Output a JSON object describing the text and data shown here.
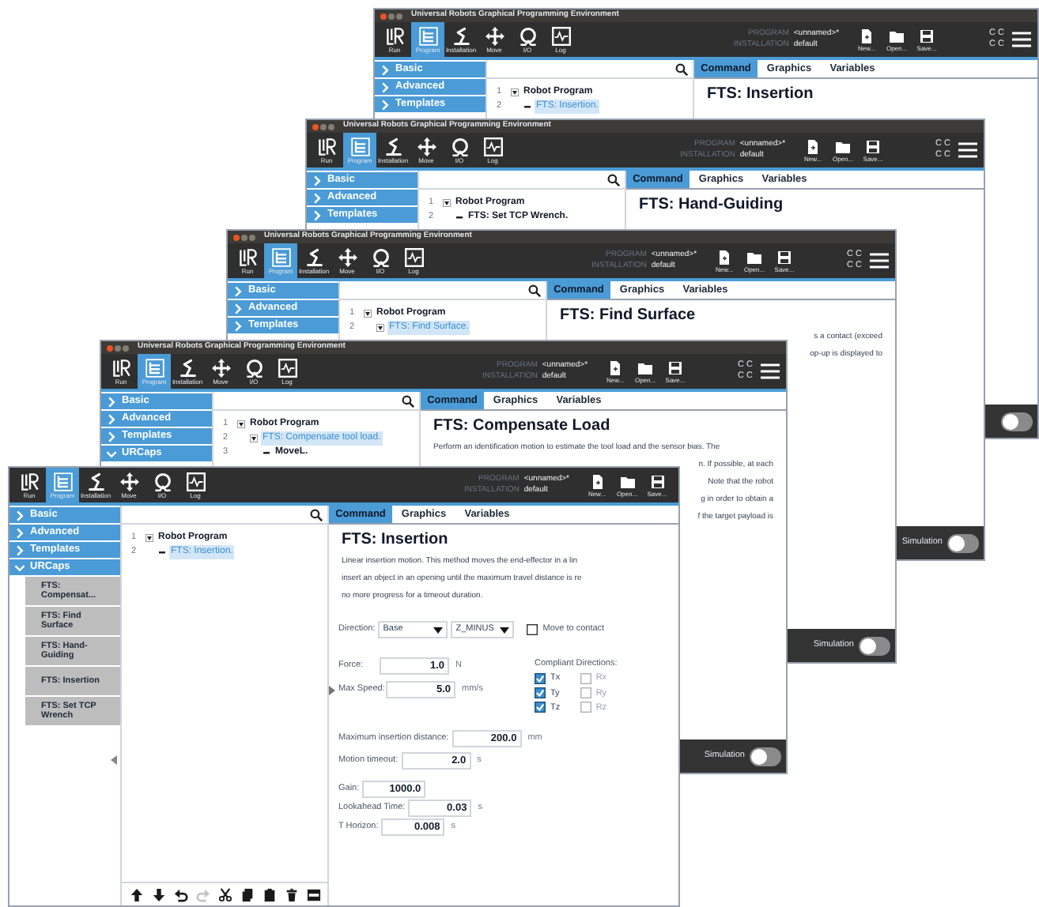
{
  "windows": [
    {
      "title": "Universal Robots Graphical Programming Environment",
      "toolbar": {
        "nav": [
          {
            "label": "Run",
            "kind": "run",
            "selected": false
          },
          {
            "label": "Program",
            "kind": "program",
            "selected": true
          },
          {
            "label": "Installation",
            "kind": "installation",
            "selected": false
          },
          {
            "label": "Move",
            "kind": "move",
            "selected": false
          },
          {
            "label": "I/O",
            "kind": "io",
            "selected": false
          },
          {
            "label": "Log",
            "kind": "log",
            "selected": false
          }
        ],
        "program_label": "PROGRAM",
        "program": "<unnamed>*",
        "installation_label": "INSTALLATION",
        "installation": "default",
        "files": [
          {
            "label": "New...",
            "kind": "new"
          },
          {
            "label": "Open...",
            "kind": "open"
          },
          {
            "label": "Save...",
            "kind": "save"
          }
        ],
        "status": [
          "C C",
          "C C"
        ],
        "menu": true
      },
      "sidebar": [
        {
          "label": "Basic",
          "expanded": false
        },
        {
          "label": "Advanced",
          "expanded": false
        },
        {
          "label": "Templates",
          "expanded": false
        }
      ],
      "tree": [
        {
          "number": "1",
          "label": "Robot Program",
          "expanded": true,
          "selected": false,
          "children": [
            {
              "number": "2",
              "label": "FTS: Insertion.",
              "expanded": false,
              "selected": true
            }
          ]
        }
      ],
      "tabs": [
        {
          "label": "Command",
          "selected": true
        },
        {
          "label": "Graphics",
          "selected": false
        },
        {
          "label": "Variables",
          "selected": false
        }
      ],
      "heading": "FTS: Insertion",
      "simulation": {
        "on": false
      }
    },
    {
      "title": "Universal Robots Graphical Programming Environment",
      "toolbar": {
        "nav": [
          {
            "label": "Run",
            "kind": "run",
            "selected": false
          },
          {
            "label": "Program",
            "kind": "program",
            "selected": true
          },
          {
            "label": "Installation",
            "kind": "installation",
            "selected": false
          },
          {
            "label": "Move",
            "kind": "move",
            "selected": false
          },
          {
            "label": "I/O",
            "kind": "io",
            "selected": false
          },
          {
            "label": "Log",
            "kind": "log",
            "selected": false
          }
        ],
        "program_label": "PROGRAM",
        "program": "<unnamed>*",
        "installation_label": "INSTALLATION",
        "installation": "default",
        "files": [
          {
            "label": "New...",
            "kind": "new"
          },
          {
            "label": "Open...",
            "kind": "open"
          },
          {
            "label": "Save...",
            "kind": "save"
          }
        ],
        "status": [
          "C C",
          "C C"
        ],
        "menu": true
      },
      "sidebar": [
        {
          "label": "Basic",
          "expanded": false
        },
        {
          "label": "Advanced",
          "expanded": false
        },
        {
          "label": "Templates",
          "expanded": false
        }
      ],
      "tree": [
        {
          "number": "1",
          "label": "Robot Program",
          "expanded": true,
          "selected": false,
          "children": [
            {
              "number": "2",
              "label": "FTS: Set TCP Wrench.",
              "expanded": false,
              "selected": false
            }
          ]
        }
      ],
      "tabs": [
        {
          "label": "Command",
          "selected": true
        },
        {
          "label": "Graphics",
          "selected": false
        },
        {
          "label": "Variables",
          "selected": false
        }
      ],
      "heading": "FTS: Hand-Guiding",
      "simulation": {
        "label": "Simulation",
        "on": false
      }
    },
    {
      "title": "Universal Robots Graphical Programming Environment",
      "toolbar": {
        "nav": [
          {
            "label": "Run",
            "kind": "run",
            "selected": false
          },
          {
            "label": "Program",
            "kind": "program",
            "selected": true
          },
          {
            "label": "Installation",
            "kind": "installation",
            "selected": false
          },
          {
            "label": "Move",
            "kind": "move",
            "selected": false
          },
          {
            "label": "I/O",
            "kind": "io",
            "selected": false
          },
          {
            "label": "Log",
            "kind": "log",
            "selected": false
          }
        ],
        "program_label": "PROGRAM",
        "program": "<unnamed>*",
        "installation_label": "INSTALLATION",
        "installation": "default",
        "files": [
          {
            "label": "New...",
            "kind": "new"
          },
          {
            "label": "Open...",
            "kind": "open"
          },
          {
            "label": "Save...",
            "kind": "save"
          }
        ],
        "status": [
          "C C",
          "C C"
        ],
        "menu": true
      },
      "sidebar": [
        {
          "label": "Basic",
          "expanded": false
        },
        {
          "label": "Advanced",
          "expanded": false
        },
        {
          "label": "Templates",
          "expanded": false
        }
      ],
      "tree": [
        {
          "number": "1",
          "label": "Robot Program",
          "expanded": true,
          "selected": false,
          "children": [
            {
              "number": "2",
              "label": "FTS: Find Surface.",
              "expanded": true,
              "selected": true
            }
          ]
        }
      ],
      "tabs": [
        {
          "label": "Command",
          "selected": true
        },
        {
          "label": "Graphics",
          "selected": false
        },
        {
          "label": "Variables",
          "selected": false
        }
      ],
      "heading": "FTS: Find Surface",
      "description": [
        {
          "text": "s a contact (exceed",
          "kind": "tail"
        },
        {
          "text": "op-up is displayed to",
          "kind": "tail"
        }
      ],
      "simulation": {
        "label": "Simulation",
        "on": false
      }
    },
    {
      "title": "Universal Robots Graphical Programming Environment",
      "toolbar": {
        "nav": [
          {
            "label": "Run",
            "kind": "run",
            "selected": false
          },
          {
            "label": "Program",
            "kind": "program",
            "selected": true
          },
          {
            "label": "Installation",
            "kind": "installation",
            "selected": false
          },
          {
            "label": "Move",
            "kind": "move",
            "selected": false
          },
          {
            "label": "I/O",
            "kind": "io",
            "selected": false
          },
          {
            "label": "Log",
            "kind": "log",
            "selected": false
          }
        ],
        "program_label": "PROGRAM",
        "program": "<unnamed>*",
        "installation_label": "INSTALLATION",
        "installation": "default",
        "files": [
          {
            "label": "New...",
            "kind": "new"
          },
          {
            "label": "Open...",
            "kind": "open"
          },
          {
            "label": "Save...",
            "kind": "save"
          }
        ],
        "status": [
          "C C",
          "C C"
        ],
        "menu": true
      },
      "sidebar": [
        {
          "label": "Basic",
          "expanded": false
        },
        {
          "label": "Advanced",
          "expanded": false
        },
        {
          "label": "Templates",
          "expanded": false
        },
        {
          "label": "URCaps",
          "expanded": true
        }
      ],
      "tree": [
        {
          "number": "1",
          "label": "Robot Program",
          "expanded": true,
          "selected": false,
          "children": [
            {
              "number": "2",
              "label": "FTS: Compensate tool load.",
              "expanded": true,
              "selected": true,
              "children": [
                {
                  "number": "3",
                  "label": "MoveL.",
                  "expanded": false,
                  "selected": false
                }
              ]
            }
          ]
        }
      ],
      "tabs": [
        {
          "label": "Command",
          "selected": true
        },
        {
          "label": "Graphics",
          "selected": false
        },
        {
          "label": "Variables",
          "selected": false
        }
      ],
      "heading": "FTS: Compensate Load",
      "description": [
        {
          "text": "Perform an identification motion to estimate the tool load and the sensor bias. The",
          "kind": "line"
        },
        {
          "text": "n. If possible, at each",
          "kind": "tail"
        },
        {
          "text": "Note that the robot",
          "kind": "tail"
        },
        {
          "text": "g in order to obtain a",
          "kind": "tail"
        },
        {
          "text": "f the target payload is",
          "kind": "tail"
        }
      ],
      "simulation": {
        "label": "Simulation",
        "on": false
      }
    },
    {
      "toolbar": {
        "nav": [
          {
            "label": "Run",
            "kind": "run",
            "selected": false
          },
          {
            "label": "Program",
            "kind": "program",
            "selected": true
          },
          {
            "label": "Installation",
            "kind": "installation",
            "selected": false
          },
          {
            "label": "Move",
            "kind": "move",
            "selected": false
          },
          {
            "label": "I/O",
            "kind": "io",
            "selected": false
          },
          {
            "label": "Log",
            "kind": "log",
            "selected": false
          }
        ],
        "program_label": "PROGRAM",
        "program": "<unnamed>*",
        "installation_label": "INSTALLATION",
        "installation": "default",
        "files": [
          {
            "label": "New...",
            "kind": "new"
          },
          {
            "label": "Open...",
            "kind": "open"
          },
          {
            "label": "Save...",
            "kind": "save"
          }
        ],
        "menu": false
      },
      "sidebar": [
        {
          "label": "Basic",
          "expanded": false
        },
        {
          "label": "Advanced",
          "expanded": false
        },
        {
          "label": "Templates",
          "expanded": false
        },
        {
          "label": "URCaps",
          "expanded": true,
          "children": [
            {
              "label": "FTS: Compensat..."
            },
            {
              "label": "FTS: Find Surface"
            },
            {
              "label": "FTS: Hand-Guiding"
            },
            {
              "label": "FTS: Insertion"
            },
            {
              "label": "FTS: Set TCP Wrench"
            }
          ]
        }
      ],
      "tree": [
        {
          "number": "1",
          "label": "Robot Program",
          "expanded": true,
          "selected": false,
          "children": [
            {
              "number": "2",
              "label": "FTS: Insertion.",
              "expanded": false,
              "selected": true
            }
          ]
        }
      ],
      "tree_tools": [
        {
          "kind": "up",
          "disabled": false
        },
        {
          "kind": "down",
          "disabled": false
        },
        {
          "kind": "undo",
          "disabled": false
        },
        {
          "kind": "redo",
          "disabled": true
        },
        {
          "kind": "cut",
          "disabled": false
        },
        {
          "kind": "copy",
          "disabled": false
        },
        {
          "kind": "paste",
          "disabled": false
        },
        {
          "kind": "delete",
          "disabled": false
        },
        {
          "kind": "suppress",
          "disabled": false
        }
      ],
      "tabs": [
        {
          "label": "Command",
          "selected": true
        },
        {
          "label": "Graphics",
          "selected": false
        },
        {
          "label": "Variables",
          "selected": false
        }
      ],
      "heading": "FTS: Insertion",
      "description": [
        {
          "text": "Linear insertion motion. This method moves the end-effector in a lin",
          "kind": "line"
        },
        {
          "text": "insert an object in an opening until the maximum travel distance is re",
          "kind": "line"
        },
        {
          "text": "no more progress for a timeout duration.",
          "kind": "line"
        }
      ],
      "form": {
        "direction": {
          "label": "Direction:",
          "frame": "Base",
          "axis": "Z_MINUS",
          "contact": {
            "label": "Move to contact",
            "checked": false
          }
        },
        "force": {
          "label": "Force:",
          "value": "1.0",
          "unit": "N"
        },
        "max_speed": {
          "label": "Max Speed:",
          "value": "5.0",
          "unit": "mm/s"
        },
        "compliant": {
          "label": "Compliant Directions:",
          "axes": [
            {
              "label": "Tx",
              "checked": true,
              "disabled": false
            },
            {
              "label": "Rx",
              "checked": false,
              "disabled": true
            },
            {
              "label": "Ty",
              "checked": true,
              "disabled": false
            },
            {
              "label": "Ry",
              "checked": false,
              "disabled": true
            },
            {
              "label": "Tz",
              "checked": true,
              "disabled": false
            },
            {
              "label": "Rz",
              "checked": false,
              "disabled": true
            }
          ]
        },
        "limits": [
          {
            "label": "Maximum insertion distance:",
            "value": "200.0",
            "unit": "mm"
          },
          {
            "label": "Motion timeout:",
            "value": "2.0",
            "unit": "s"
          }
        ],
        "tuning": [
          {
            "label": "Gain:",
            "value": "1000.0"
          },
          {
            "label": "Lookahead Time:",
            "value": "0.03",
            "unit": "s"
          },
          {
            "label": "T Horizon:",
            "value": "0.008",
            "unit": "s"
          }
        ]
      }
    }
  ]
}
